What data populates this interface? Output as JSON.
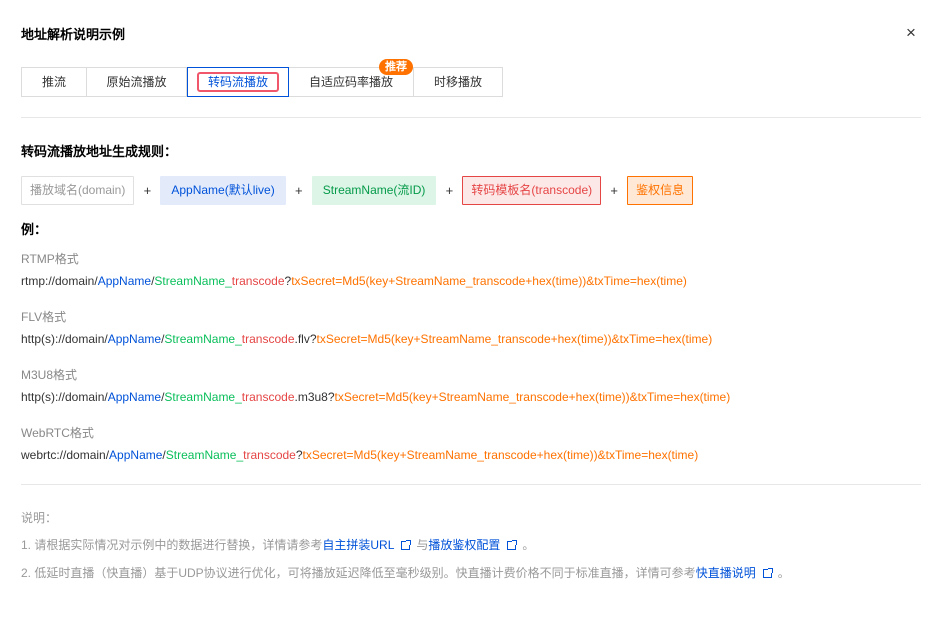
{
  "dialog": {
    "title": "地址解析说明示例",
    "close_icon": "×"
  },
  "tabs": [
    {
      "label": "推流"
    },
    {
      "label": "原始流播放"
    },
    {
      "label": "转码流播放",
      "active": true
    },
    {
      "label": "自适应码率播放",
      "badge": "推荐"
    },
    {
      "label": "时移播放"
    }
  ],
  "rule": {
    "heading": "转码流播放地址生成规则：",
    "domain": "播放域名(domain)",
    "app": "AppName(默认live)",
    "stream": "StreamName(流ID)",
    "transcode": "转码模板名(transcode)",
    "auth": "鉴权信息",
    "plus": "+"
  },
  "example_label": "例：",
  "formats": [
    {
      "label": "RTMP格式",
      "url": [
        [
          "plain",
          "rtmp://domain/"
        ],
        [
          "app",
          "AppName"
        ],
        [
          "plain",
          "/"
        ],
        [
          "stream",
          "StreamName_"
        ],
        [
          "trans",
          "transcode"
        ],
        [
          "plain",
          "?"
        ],
        [
          "auth",
          "txSecret=Md5(key+StreamName_transcode+hex(time))&txTime=hex(time)"
        ]
      ]
    },
    {
      "label": "FLV格式",
      "url": [
        [
          "plain",
          "http(s)://domain/"
        ],
        [
          "app",
          "AppName"
        ],
        [
          "plain",
          "/"
        ],
        [
          "stream",
          "StreamName_"
        ],
        [
          "trans",
          "transcode"
        ],
        [
          "plain",
          ".flv?"
        ],
        [
          "auth",
          "txSecret=Md5(key+StreamName_transcode+hex(time))&txTime=hex(time)"
        ]
      ]
    },
    {
      "label": "M3U8格式",
      "url": [
        [
          "plain",
          "http(s)://domain/"
        ],
        [
          "app",
          "AppName"
        ],
        [
          "plain",
          "/"
        ],
        [
          "stream",
          "StreamName_"
        ],
        [
          "trans",
          "transcode"
        ],
        [
          "plain",
          ".m3u8?"
        ],
        [
          "auth",
          "txSecret=Md5(key+StreamName_transcode+hex(time))&txTime=hex(time)"
        ]
      ]
    },
    {
      "label": "WebRTC格式",
      "url": [
        [
          "plain",
          "webrtc://domain/"
        ],
        [
          "app",
          "AppName"
        ],
        [
          "plain",
          "/"
        ],
        [
          "stream",
          "StreamName_"
        ],
        [
          "trans",
          "transcode"
        ],
        [
          "plain",
          "?"
        ],
        [
          "auth",
          "txSecret=Md5(key+StreamName_transcode+hex(time))&txTime=hex(time)"
        ]
      ]
    }
  ],
  "notes": {
    "heading": "说明：",
    "n1_text": "1. 请根据实际情况对示例中的数据进行替换，详情请参考",
    "n1_link1": "自主拼装URL",
    "n1_mid": "与",
    "n1_link2": "播放鉴权配置",
    "n1_end": "。",
    "n2_text": "2. 低延时直播（快直播）基于UDP协议进行优化，可将播放延迟降低至毫秒级别。快直播计费价格不同于标准直播，详情可参考",
    "n2_link": "快直播说明",
    "n2_end": "。"
  },
  "colors": {
    "primary": "#0052d9",
    "green": "#0abf5b",
    "red": "#e54545",
    "orange": "#ff7200"
  }
}
